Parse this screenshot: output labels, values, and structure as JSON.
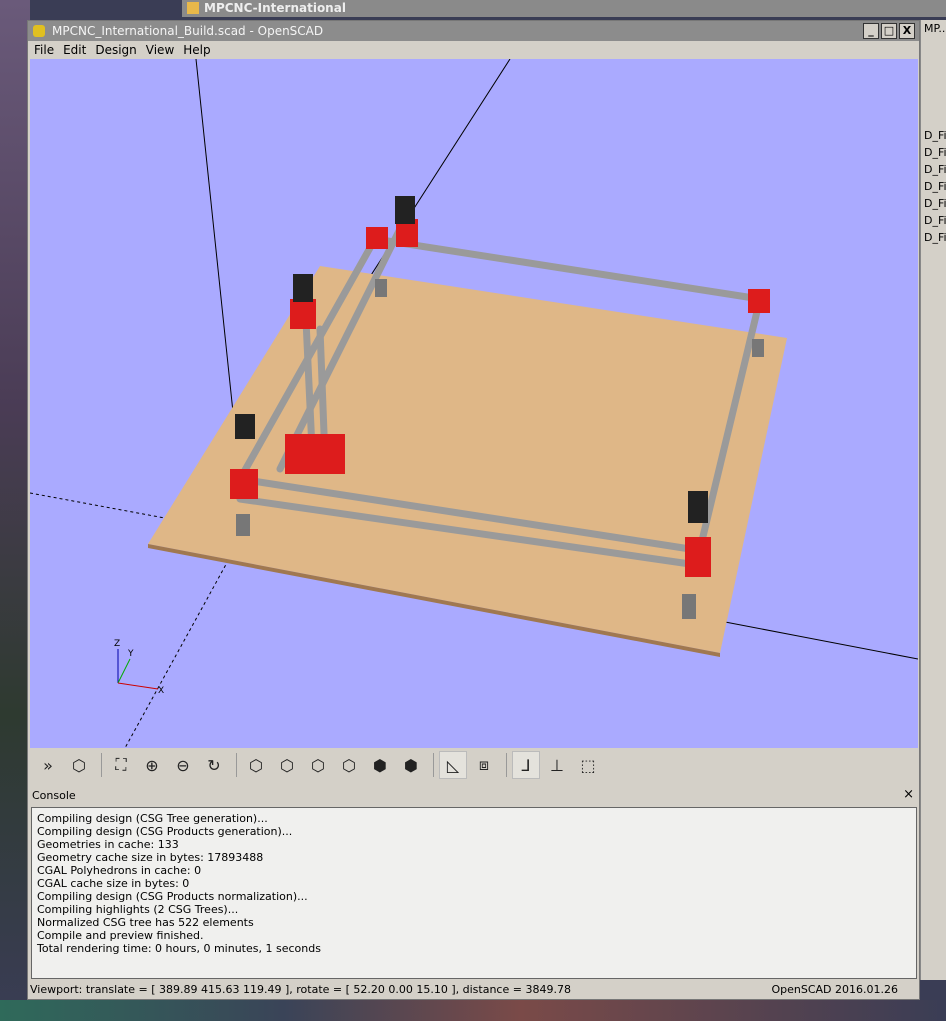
{
  "background_window": {
    "title": "MPCNC-International"
  },
  "side_panel": {
    "header": "MP..",
    "items": [
      "D_Fil",
      "D_Fil",
      "D_Fil",
      "D_Fil",
      "D_Fil",
      "D_Fil",
      "D_Fil"
    ]
  },
  "window": {
    "title": "MPCNC_International_Build.scad - OpenSCAD",
    "minimize": "_",
    "maximize": "□",
    "close": "X"
  },
  "menu": [
    "File",
    "Edit",
    "Design",
    "View",
    "Help"
  ],
  "toolbar": {
    "buttons": [
      "preview",
      "render",
      "view-all",
      "zoom-in",
      "zoom-out",
      "reset-view",
      "view-right",
      "view-top",
      "view-bottom",
      "view-left",
      "view-front",
      "view-back",
      "perspective",
      "orthogonal",
      "show-axes",
      "show-scale-markers",
      "show-edges"
    ]
  },
  "console": {
    "title": "Console",
    "close": "×",
    "lines": [
      "Compiling design (CSG Tree generation)...",
      "Compiling design (CSG Products generation)...",
      "Geometries in cache: 133",
      "Geometry cache size in bytes: 17893488",
      "CGAL Polyhedrons in cache: 0",
      "CGAL cache size in bytes: 0",
      "Compiling design (CSG Products normalization)...",
      "Compiling highlights (2 CSG Trees)...",
      "Normalized CSG tree has 522 elements",
      "Compile and preview finished.",
      "Total rendering time: 0 hours, 0 minutes, 1 seconds"
    ]
  },
  "status": {
    "viewport": "Viewport: translate = [ 389.89 415.63 119.49 ], rotate = [ 52.20 0.00 15.10 ], distance = 3849.78",
    "version": "OpenSCAD 2016.01.26"
  },
  "axes_labels": {
    "z": "Z",
    "y": "Y",
    "x": "X"
  },
  "colors": {
    "viewport": "#aaaaff",
    "board": "#dfb787",
    "parts": "#dd1c1c"
  }
}
